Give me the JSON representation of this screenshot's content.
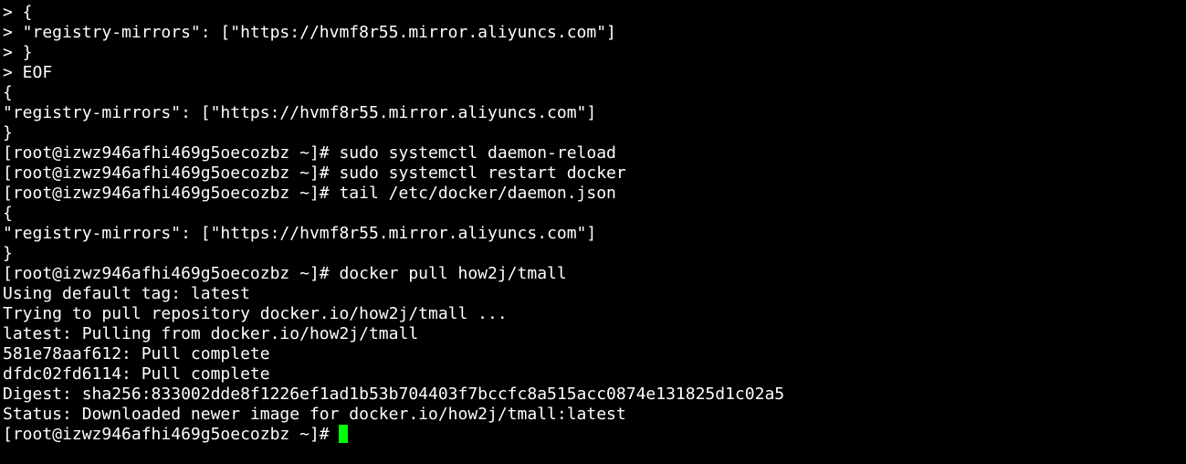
{
  "terminal": {
    "lines": [
      "> {",
      "> \"registry-mirrors\": [\"https://hvmf8r55.mirror.aliyuncs.com\"]",
      "> }",
      "> EOF",
      "{",
      "\"registry-mirrors\": [\"https://hvmf8r55.mirror.aliyuncs.com\"]",
      "}",
      "[root@izwz946afhi469g5oecozbz ~]# sudo systemctl daemon-reload",
      "[root@izwz946afhi469g5oecozbz ~]# sudo systemctl restart docker",
      "[root@izwz946afhi469g5oecozbz ~]# tail /etc/docker/daemon.json",
      "{",
      "\"registry-mirrors\": [\"https://hvmf8r55.mirror.aliyuncs.com\"]",
      "}",
      "[root@izwz946afhi469g5oecozbz ~]# docker pull how2j/tmall",
      "Using default tag: latest",
      "Trying to pull repository docker.io/how2j/tmall ...",
      "latest: Pulling from docker.io/how2j/tmall",
      "581e78aaf612: Pull complete",
      "dfdc02fd6114: Pull complete",
      "Digest: sha256:833002dde8f1226ef1ad1b53b704403f7bccfc8a515acc0874e131825d1c02a5",
      "Status: Downloaded newer image for docker.io/how2j/tmall:latest"
    ],
    "prompt": "[root@izwz946afhi469g5oecozbz ~]# ",
    "colors": {
      "background": "#000000",
      "text": "#ffffff",
      "cursor": "#00ff00"
    }
  }
}
